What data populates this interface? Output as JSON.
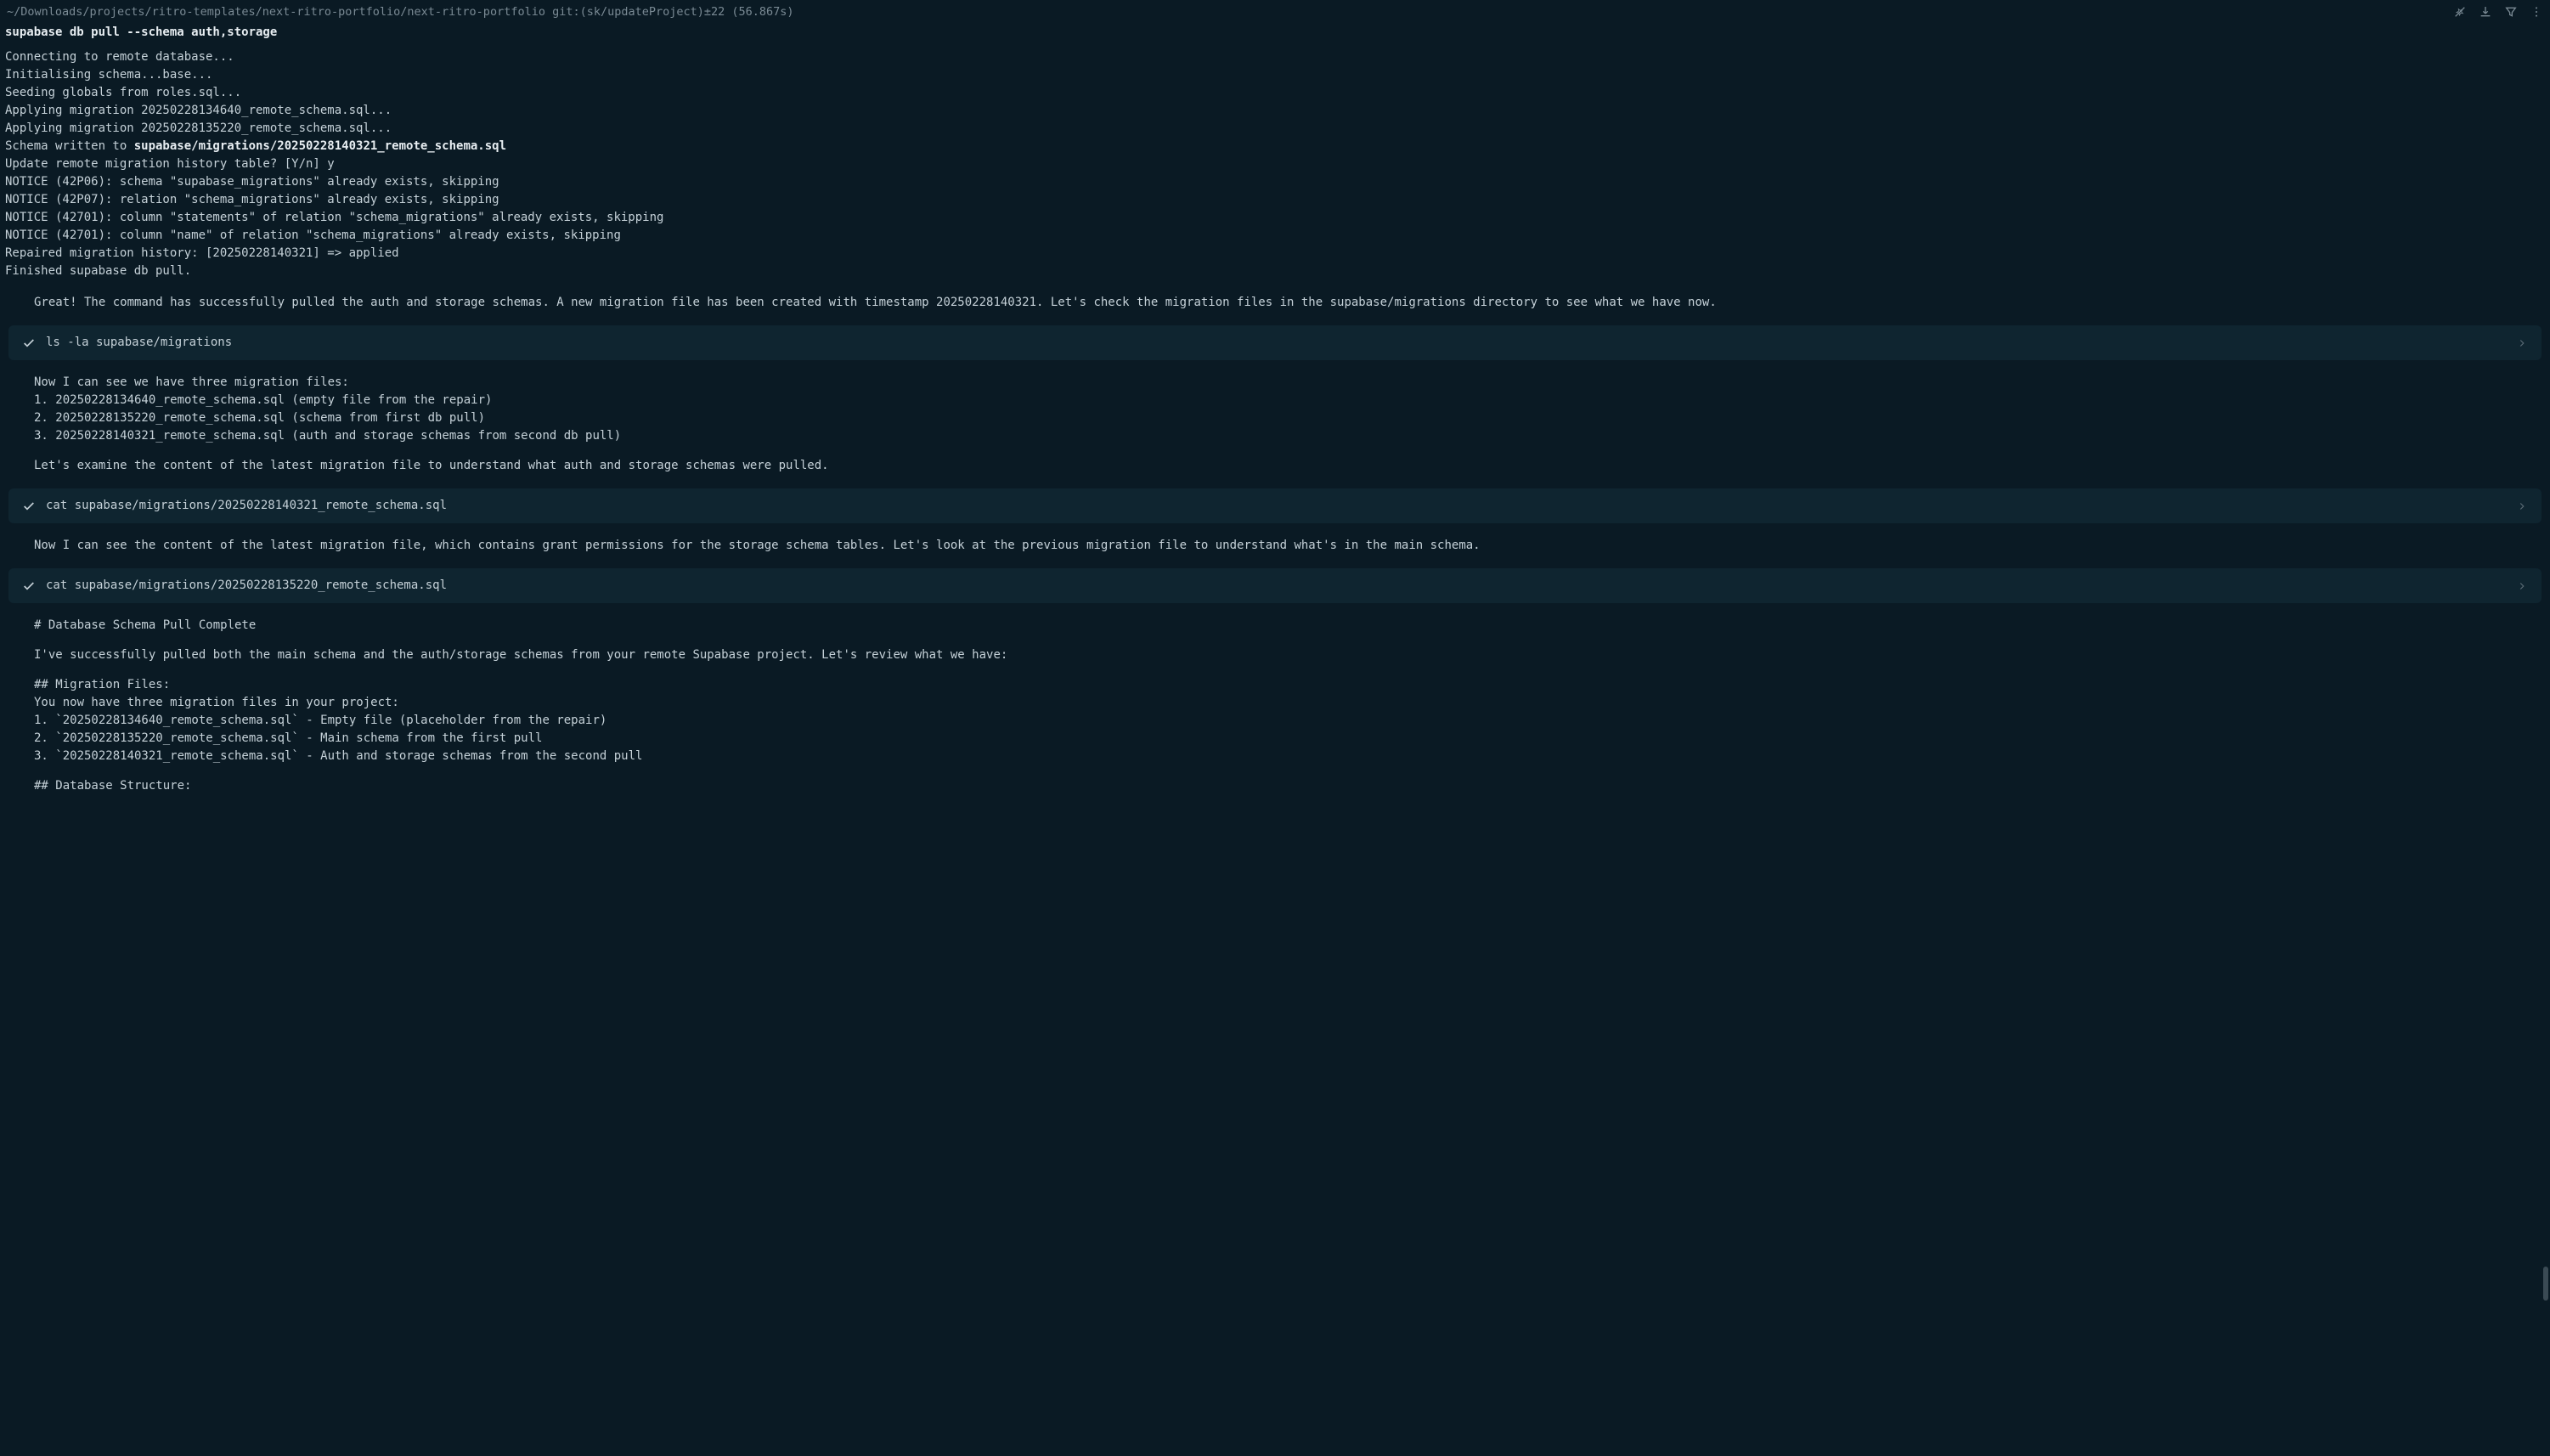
{
  "header": {
    "prompt": "~/Downloads/projects/ritro-templates/next-ritro-portfolio/next-ritro-portfolio git:(sk/updateProject)±22 (56.867s)"
  },
  "command": "supabase db pull --schema auth,storage",
  "output": {
    "l1": "Connecting to remote database...",
    "l2": "Initialising schema...base...",
    "l3": "Seeding globals from roles.sql...",
    "l4": "Applying migration 20250228134640_remote_schema.sql...",
    "l5": "Applying migration 20250228135220_remote_schema.sql...",
    "l6a": "Schema written to ",
    "l6b": "supabase/migrations/20250228140321_remote_schema.sql",
    "l7": "Update remote migration history table? [Y/n] y",
    "l8": "NOTICE (42P06): schema \"supabase_migrations\" already exists, skipping",
    "l9": "NOTICE (42P07): relation \"schema_migrations\" already exists, skipping",
    "l10": "NOTICE (42701): column \"statements\" of relation \"schema_migrations\" already exists, skipping",
    "l11": "NOTICE (42701): column \"name\" of relation \"schema_migrations\" already exists, skipping",
    "l12": "Repaired migration history: [20250228140321] => applied",
    "l13": "Finished supabase db pull."
  },
  "assistant1": "Great! The command has successfully pulled the auth and storage schemas. A new migration file has been created with timestamp 20250228140321. Let's check the migration files in the supabase/migrations directory to see what we have now.",
  "tool1": "ls -la supabase/migrations",
  "assistant2": {
    "intro": "Now I can see we have three migration files:",
    "items": [
      "1. 20250228134640_remote_schema.sql (empty file from the repair)",
      "2. 20250228135220_remote_schema.sql (schema from first db pull)",
      "3. 20250228140321_remote_schema.sql (auth and storage schemas from second db pull)"
    ],
    "outro": "Let's examine the content of the latest migration file to understand what auth and storage schemas were pulled."
  },
  "tool2": "cat supabase/migrations/20250228140321_remote_schema.sql",
  "assistant3": "Now I can see the content of the latest migration file, which contains grant permissions for the storage schema tables. Let's look at the previous migration file to understand what's in the main schema.",
  "tool3": "cat supabase/migrations/20250228135220_remote_schema.sql",
  "assistant4": {
    "h1": "# Database Schema Pull Complete",
    "p1": "I've successfully pulled both the main schema and the auth/storage schemas from your remote Supabase project. Let's review what we have:",
    "h2a": "## Migration Files:",
    "p2": "You now have three migration files in your project:",
    "items": [
      "1. `20250228134640_remote_schema.sql` - Empty file (placeholder from the repair)",
      "2. `20250228135220_remote_schema.sql` - Main schema from the first pull",
      "3. `20250228140321_remote_schema.sql` - Auth and storage schemas from the second pull"
    ],
    "h2b": "## Database Structure:"
  }
}
